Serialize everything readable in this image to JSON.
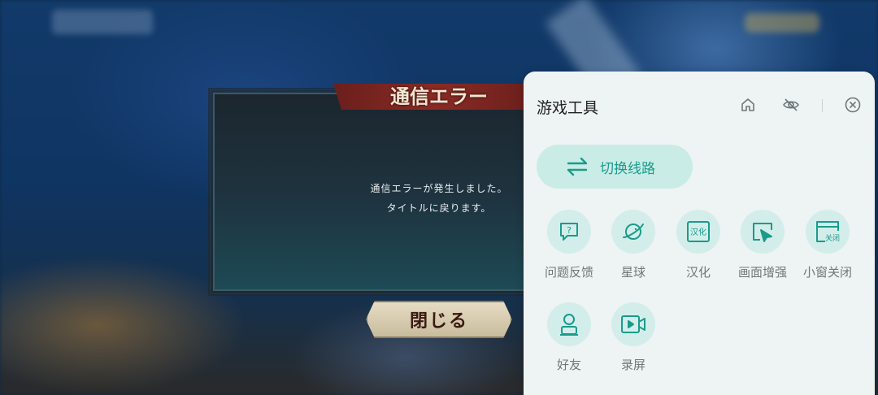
{
  "game": {
    "dialog_title": "通信エラー",
    "message_line1": "通信エラーが発生しました。",
    "message_line2": "タイトルに戻ります。",
    "close_label": "閉じる"
  },
  "panel": {
    "title": "游戏工具",
    "header_icons": [
      "home-icon",
      "eye-off-icon",
      "close-circle-icon"
    ],
    "switch_route_label": "切换线路",
    "tools": [
      {
        "label": "问题反馈",
        "icon": "feedback-icon"
      },
      {
        "label": "星球",
        "icon": "planet-icon"
      },
      {
        "label": "汉化",
        "icon": "translate-icon",
        "icon_text": "汉化"
      },
      {
        "label": "画面增强",
        "icon": "enhance-icon"
      },
      {
        "label": "小窗关闭",
        "icon": "mini-window-close-icon",
        "icon_text": "关闭"
      },
      {
        "label": "好友",
        "icon": "friend-icon"
      },
      {
        "label": "录屏",
        "icon": "record-icon"
      }
    ],
    "accent_color": "#1a9b8c",
    "circle_color": "#d3eeea"
  }
}
